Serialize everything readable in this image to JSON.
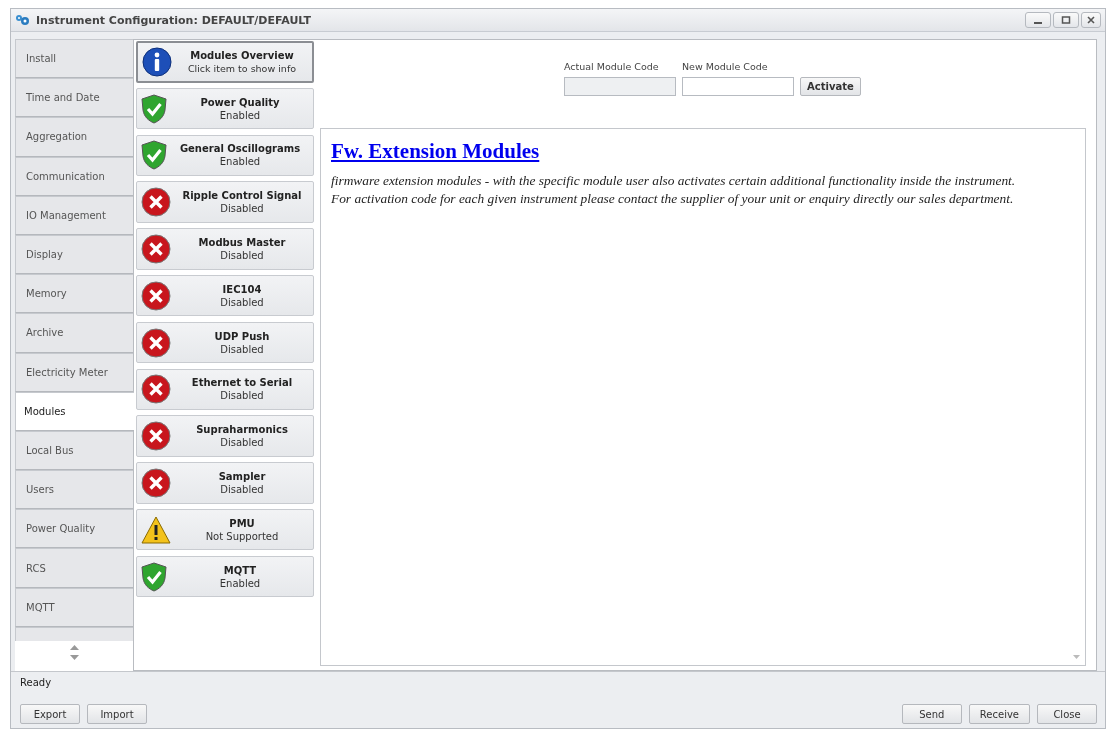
{
  "window": {
    "title": "Instrument Configuration: DEFAULT/DEFAULT"
  },
  "tabs": [
    {
      "label": "Install",
      "selected": false
    },
    {
      "label": "Time and Date",
      "selected": false
    },
    {
      "label": "Aggregation",
      "selected": false
    },
    {
      "label": "Communication",
      "selected": false
    },
    {
      "label": "IO Management",
      "selected": false
    },
    {
      "label": "Display",
      "selected": false
    },
    {
      "label": "Memory",
      "selected": false
    },
    {
      "label": "Archive",
      "selected": false
    },
    {
      "label": "Electricity Meter",
      "selected": false
    },
    {
      "label": "Modules",
      "selected": true
    },
    {
      "label": "Local Bus",
      "selected": false
    },
    {
      "label": "Users",
      "selected": false
    },
    {
      "label": "Power Quality",
      "selected": false
    },
    {
      "label": "RCS",
      "selected": false
    },
    {
      "label": "MQTT",
      "selected": false
    }
  ],
  "modules": [
    {
      "name": "Modules Overview",
      "status": "Click item to show info",
      "kind": "info",
      "selected": true
    },
    {
      "name": "Power Quality",
      "status": "Enabled",
      "kind": "enabled",
      "selected": false
    },
    {
      "name": "General Oscillograms",
      "status": "Enabled",
      "kind": "enabled",
      "selected": false
    },
    {
      "name": "Ripple Control Signal",
      "status": "Disabled",
      "kind": "disabled",
      "selected": false
    },
    {
      "name": "Modbus Master",
      "status": "Disabled",
      "kind": "disabled",
      "selected": false
    },
    {
      "name": "IEC104",
      "status": "Disabled",
      "kind": "disabled",
      "selected": false
    },
    {
      "name": "UDP Push",
      "status": "Disabled",
      "kind": "disabled",
      "selected": false
    },
    {
      "name": "Ethernet to Serial",
      "status": "Disabled",
      "kind": "disabled",
      "selected": false
    },
    {
      "name": "Supraharmonics",
      "status": "Disabled",
      "kind": "disabled",
      "selected": false
    },
    {
      "name": "Sampler",
      "status": "Disabled",
      "kind": "disabled",
      "selected": false
    },
    {
      "name": "PMU",
      "status": "Not Supported",
      "kind": "unsupported",
      "selected": false
    },
    {
      "name": "MQTT",
      "status": "Enabled",
      "kind": "enabled",
      "selected": false
    }
  ],
  "code_form": {
    "actual_label": "Actual Module Code",
    "new_label": "New Module Code",
    "activate_button": "Activate"
  },
  "info": {
    "heading": "Fw. Extension Modules",
    "lines": [
      "firmware extension modules - with the specific module user also activates certain additional functionality inside the instrument.",
      "For activation code for each given instrument please contact the supplier of your unit or enquiry directly our sales department."
    ]
  },
  "status_bar": {
    "text": "Ready"
  },
  "buttons_left": [
    "Export",
    "Import"
  ],
  "buttons_right": [
    "Send",
    "Receive",
    "Close"
  ]
}
